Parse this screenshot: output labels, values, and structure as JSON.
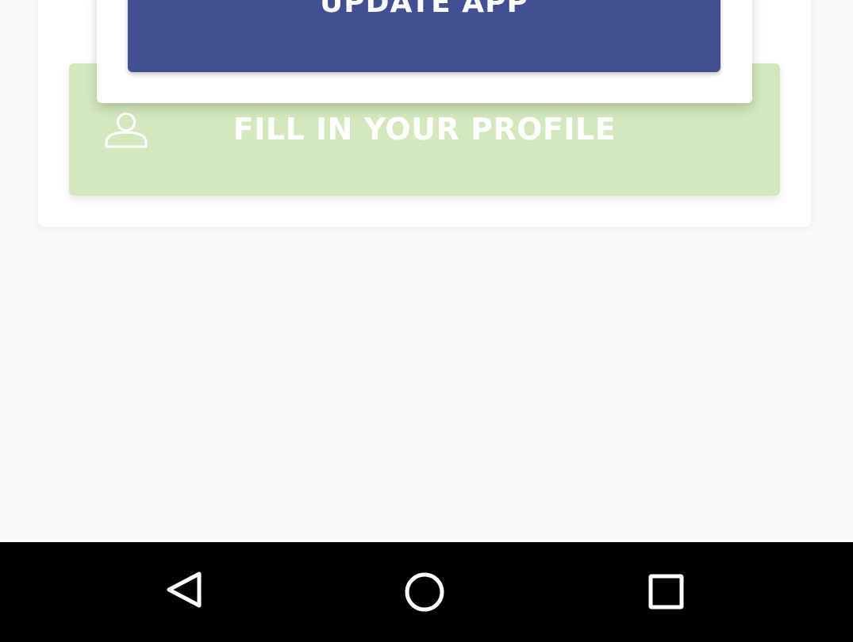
{
  "update": {
    "label": "UPDATE APP"
  },
  "profile": {
    "label": "FILL IN YOUR PROFILE",
    "icon": "person-icon"
  },
  "navbar": {
    "back_icon": "back-triangle-icon",
    "home_icon": "home-circle-icon",
    "recents_icon": "recents-square-icon"
  },
  "colors": {
    "background": "#f8f9fb",
    "update_button": "#434f93",
    "profile_button": "#d3e8bc",
    "navbar": "#000000"
  }
}
